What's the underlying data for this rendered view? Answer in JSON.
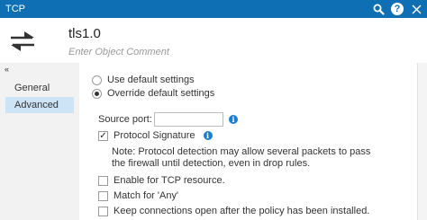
{
  "window": {
    "title": "TCP",
    "icons": [
      "search-icon",
      "help-icon",
      "close-icon"
    ]
  },
  "header": {
    "object_name": "tls1.0",
    "comment_placeholder": "Enter Object Comment",
    "icon": "tcp-service-icon"
  },
  "sidebar": {
    "collapse_glyph": "«",
    "items": [
      {
        "label": "General",
        "selected": false
      },
      {
        "label": "Advanced",
        "selected": true
      }
    ]
  },
  "advanced": {
    "settings_mode": {
      "options": [
        "Use default settings",
        "Override default settings"
      ],
      "selected": "Override default settings"
    },
    "source_port": {
      "label": "Source port:",
      "value": ""
    },
    "protocol_signature": {
      "label": "Protocol Signature",
      "checked": true
    },
    "note": "Note: Protocol detection may allow several packets to pass the firewall until detection, even in drop rules.",
    "enable_tcp": {
      "label": "Enable for TCP resource.",
      "checked": false
    },
    "match_any": {
      "label": "Match for 'Any'",
      "checked": false
    },
    "keep_connections": {
      "label": "Keep connections open after the policy has been installed.",
      "checked": false
    }
  },
  "colors": {
    "titlebar": "#0f6fb5",
    "selected_nav": "#cde4f7",
    "info_icon": "#1b7dd4"
  }
}
